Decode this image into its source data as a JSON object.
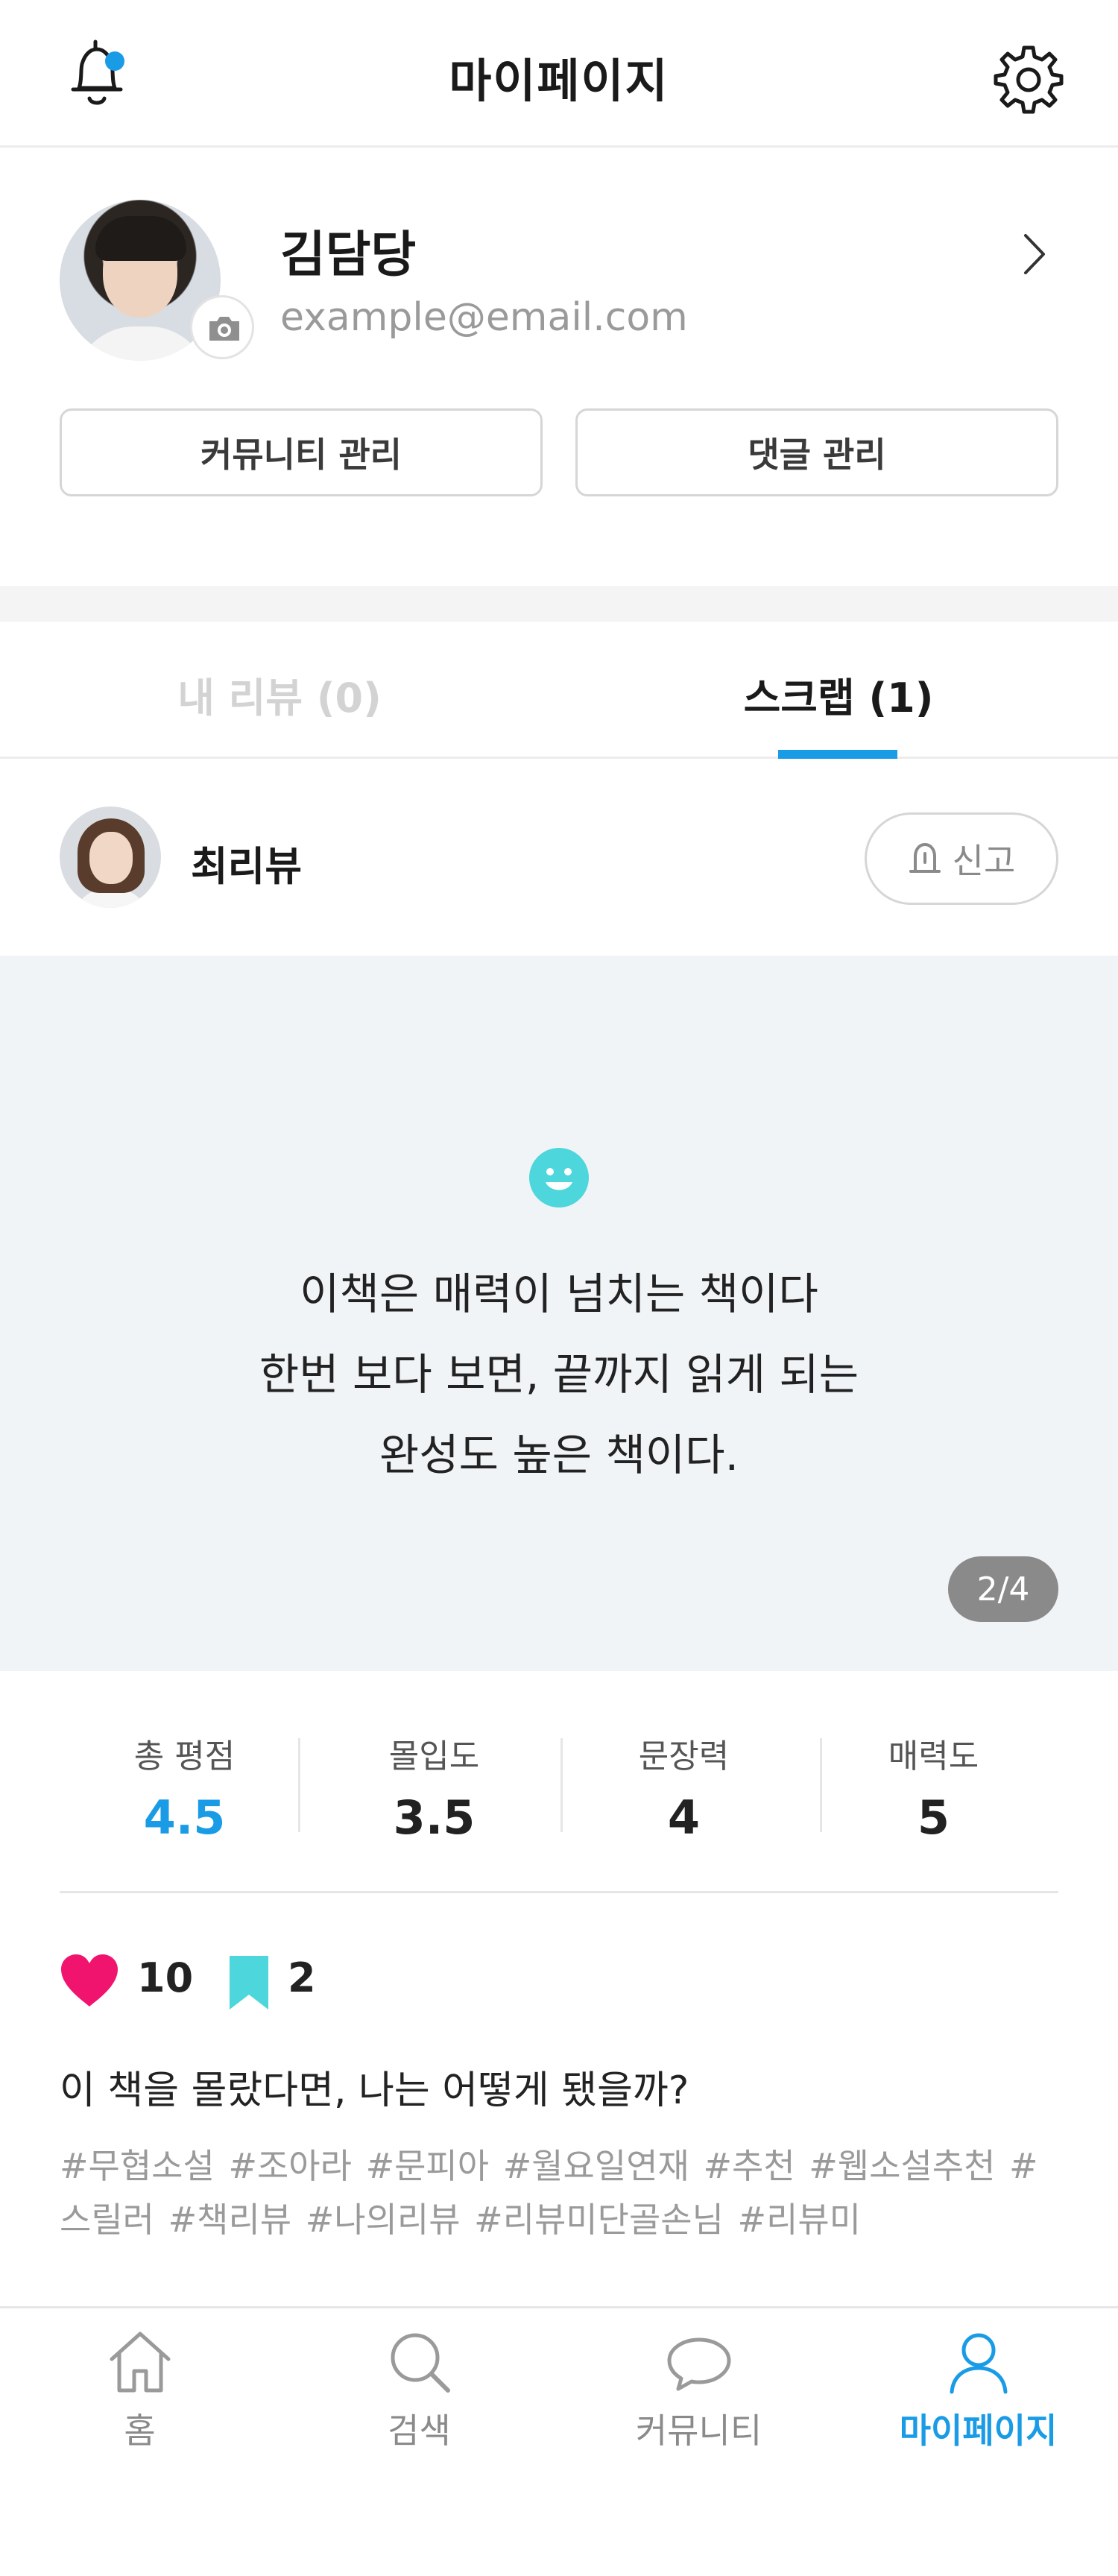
{
  "header": {
    "title": "마이페이지",
    "icons": [
      "bell-icon",
      "gear-icon"
    ],
    "notification_dot_color": "#1a9be6"
  },
  "profile": {
    "name": "김담당",
    "email": "example@email.com",
    "buttons": {
      "community": "커뮤니티 관리",
      "comments": "댓글 관리"
    }
  },
  "tabs": [
    {
      "label": "내 리뷰 (0)",
      "active": false
    },
    {
      "label": "스크랩 (1)",
      "active": true
    }
  ],
  "review": {
    "reviewer": "최리뷰",
    "report_label": "신고",
    "quote_lines": [
      "이책은 매력이 넘치는 책이다",
      "한번 보다 보면, 끝까지 읽게 되는",
      "완성도 높은 책이다."
    ],
    "page_indicator": "2/4",
    "ratings": [
      {
        "label": "총 평점",
        "value": "4.5"
      },
      {
        "label": "몰입도",
        "value": "3.5"
      },
      {
        "label": "문장력",
        "value": "4"
      },
      {
        "label": "매력도",
        "value": "5"
      }
    ],
    "likes": "10",
    "scraps": "2",
    "title": "이 책을 몰랐다면, 나는 어떻게 됐을까?",
    "hashtags": "#무협소설 #조아라 #문피아 #월요일연재 #추천 #웹소설추천 #스릴러 #책리뷰 #나의리뷰 #리뷰미단골손님 #리뷰미"
  },
  "bottom_nav": [
    {
      "label": "홈",
      "icon": "home-icon",
      "active": false
    },
    {
      "label": "검색",
      "icon": "search-icon",
      "active": false
    },
    {
      "label": "커뮤니티",
      "icon": "chat-icon",
      "active": false
    },
    {
      "label": "마이페이지",
      "icon": "user-icon",
      "active": true
    }
  ],
  "colors": {
    "accent": "#1a9be6",
    "heart": "#f0146e",
    "bookmark": "#4dd6dc",
    "quote_bg": "#f1f4f7"
  }
}
